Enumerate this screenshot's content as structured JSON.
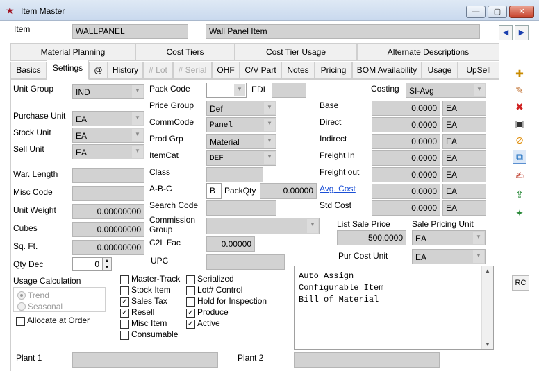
{
  "window": {
    "title": "Item Master",
    "minimize": "—",
    "maximize": "▢",
    "close": "✕"
  },
  "header": {
    "item_label": "Item",
    "item_value": "WALLPANEL",
    "description_value": "Wall Panel Item",
    "prev": "◀",
    "next": "▶"
  },
  "tabs_row1": [
    "Material Planning",
    "Cost Tiers",
    "Cost Tier Usage",
    "Alternate Descriptions"
  ],
  "tabs_row2": [
    "Basics",
    "Settings",
    "@",
    "History",
    "# Lot",
    "# Serial",
    "OHF",
    "C/V Part",
    "Notes",
    "Pricing",
    "BOM Availability",
    "Usage",
    "UpSell"
  ],
  "left": {
    "unit_group_label": "Unit Group",
    "unit_group_value": "IND",
    "purchase_unit_label": "Purchase Unit",
    "purchase_unit_value": "EA",
    "stock_unit_label": "Stock Unit",
    "stock_unit_value": "EA",
    "sell_unit_label": "Sell Unit",
    "sell_unit_value": "EA",
    "war_length_label": "War. Length",
    "misc_code_label": "Misc Code",
    "unit_weight_label": "Unit Weight",
    "unit_weight_value": "0.00000000",
    "cubes_label": "Cubes",
    "cubes_value": "0.00000000",
    "sqft_label": "Sq. Ft.",
    "sqft_value": "0.00000000",
    "qty_dec_label": "Qty Dec",
    "qty_dec_value": "0",
    "usage_calc_label": "Usage Calculation",
    "trend_label": "Trend",
    "seasonal_label": "Seasonal",
    "allocate_label": "Allocate at Order"
  },
  "middle": {
    "pack_code_label": "Pack Code",
    "edi_label": "EDI",
    "price_group_label": "Price Group",
    "price_group_value": "Def",
    "commcode_label": "CommCode",
    "commcode_value": "Panel",
    "prod_grp_label": "Prod Grp",
    "prod_grp_value": "Material",
    "itemcat_label": "ItemCat",
    "itemcat_value": "DEF",
    "class_label": "Class",
    "abc_label": "A-B-C",
    "abc_value": "B",
    "packqty_label": "PackQty",
    "packqty_value": "0.00000",
    "search_code_label": "Search Code",
    "commission_group_label": "Commission Group",
    "c2l_fac_label": "C2L Fac",
    "c2l_fac_value": "0.00000",
    "upc_label": "UPC"
  },
  "costing": {
    "costing_label": "Costing",
    "costing_value": "SI-Avg",
    "rows": [
      {
        "label": "Base",
        "value": "0.0000",
        "unit": "EA"
      },
      {
        "label": "Direct",
        "value": "0.0000",
        "unit": "EA"
      },
      {
        "label": "Indirect",
        "value": "0.0000",
        "unit": "EA"
      },
      {
        "label": "Freight In",
        "value": "0.0000",
        "unit": "EA"
      },
      {
        "label": "Freight out",
        "value": "0.0000",
        "unit": "EA"
      },
      {
        "label": "Avg. Cost",
        "value": "0.0000",
        "unit": "EA"
      },
      {
        "label": "Std Cost",
        "value": "0.0000",
        "unit": "EA"
      }
    ],
    "list_sale_price_label": "List Sale Price",
    "list_sale_price_value": "500.0000",
    "sale_pricing_unit_label": "Sale Pricing Unit",
    "sale_pricing_unit_value": "EA",
    "pur_cost_unit_label": "Pur Cost Unit",
    "pur_cost_unit_value": "EA"
  },
  "checkboxes_col1": [
    {
      "label": "Master-Track",
      "checked": false
    },
    {
      "label": "Stock Item",
      "checked": false
    },
    {
      "label": "Sales Tax",
      "checked": true
    },
    {
      "label": "Resell",
      "checked": true
    },
    {
      "label": "Misc Item",
      "checked": false
    },
    {
      "label": "Consumable",
      "checked": false
    }
  ],
  "checkboxes_col2": [
    {
      "label": "Serialized",
      "checked": false
    },
    {
      "label": "Lot# Control",
      "checked": false
    },
    {
      "label": "Hold for Inspection",
      "checked": false
    },
    {
      "label": "Produce",
      "checked": true
    },
    {
      "label": "Active",
      "checked": true
    }
  ],
  "notes_text": "Auto Assign\nConfigurable Item\nBill of Material",
  "plants": {
    "plant1_label": "Plant 1",
    "plant2_label": "Plant 2"
  },
  "toolbar": {
    "rc_label": "RC"
  },
  "colors": {
    "field_bg": "#d2d2d2",
    "link": "#1a4fd6",
    "title_gradient": "#c9d9ee"
  }
}
